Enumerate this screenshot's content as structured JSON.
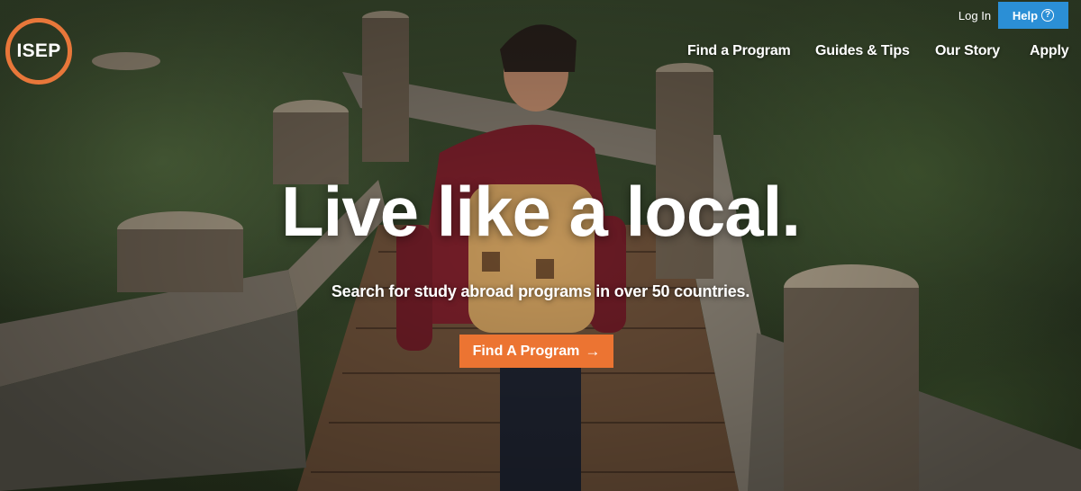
{
  "brand": {
    "logo_text": "ISEP",
    "accent": "#e8773a"
  },
  "utility": {
    "login_label": "Log In",
    "help_label": "Help",
    "help_icon": "question-circle-icon",
    "help_color": "#2b8fd6"
  },
  "nav": {
    "items": [
      {
        "label": "Find a Program"
      },
      {
        "label": "Guides & Tips"
      },
      {
        "label": "Our Story"
      },
      {
        "label": "Apply"
      }
    ]
  },
  "hero": {
    "headline": "Live like a local.",
    "subtitle": "Search for study abroad programs in over 50 countries.",
    "cta_label": "Find A Program",
    "cta_icon": "arrow-right-icon",
    "cta_color": "#ec7432",
    "background": "photo of a student with a backpack walking down a wooden boardwalk through greenery"
  }
}
